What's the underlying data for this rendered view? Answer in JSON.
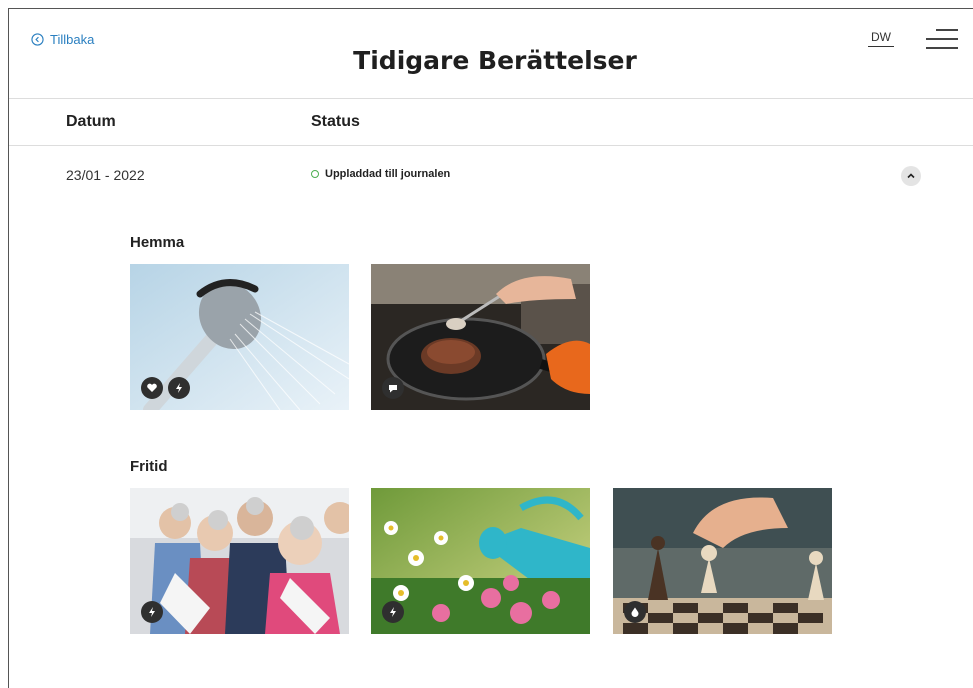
{
  "nav": {
    "back_label": "Tillbaka",
    "user_initials": "DW"
  },
  "page": {
    "title": "Tidigare Berättelser"
  },
  "table": {
    "headers": {
      "date": "Datum",
      "status": "Status"
    },
    "rows": [
      {
        "date": "23/01 - 2022",
        "status": "Uppladdad till journalen",
        "status_color": "#4caf50"
      }
    ]
  },
  "groups": [
    {
      "title": "Hemma",
      "images": [
        {
          "subject": "shower",
          "badges": [
            "heart-icon",
            "lightning-icon"
          ]
        },
        {
          "subject": "cooking",
          "badges": [
            "speech-icon"
          ]
        }
      ]
    },
    {
      "title": "Fritid",
      "images": [
        {
          "subject": "choir",
          "badges": [
            "lightning-icon"
          ]
        },
        {
          "subject": "gardening",
          "badges": [
            "lightning-icon"
          ]
        },
        {
          "subject": "chess",
          "badges": [
            "drop-icon"
          ]
        }
      ]
    }
  ],
  "colors": {
    "link": "#2a7fc0",
    "status_ok": "#4caf50"
  }
}
